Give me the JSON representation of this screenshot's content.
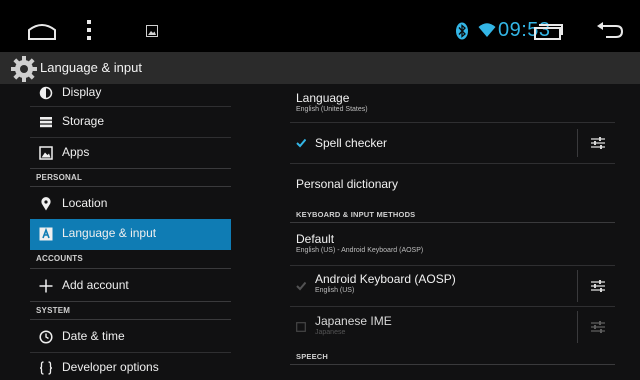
{
  "status_bar": {
    "time": "09:53",
    "icons": [
      "home-icon",
      "menu-icon",
      "screenshot-icon",
      "bluetooth-icon",
      "wifi-icon",
      "recent-apps-icon",
      "back-icon"
    ],
    "accent_color": "#33b5e5"
  },
  "action_bar": {
    "icon": "settings-gear-icon",
    "title": "Language & input"
  },
  "sidebar": {
    "items": [
      {
        "label": "Display",
        "icon": "display-icon"
      },
      {
        "label": "Storage",
        "icon": "storage-icon"
      },
      {
        "label": "Apps",
        "icon": "apps-icon"
      },
      {
        "label": "Location",
        "icon": "location-icon"
      },
      {
        "label": "Language & input",
        "icon": "language-icon",
        "selected": true
      },
      {
        "label": "Add account",
        "icon": "add-icon"
      },
      {
        "label": "Date & time",
        "icon": "clock-icon"
      },
      {
        "label": "Developer options",
        "icon": "braces-icon"
      }
    ],
    "sections": [
      "PERSONAL",
      "ACCOUNTS",
      "SYSTEM"
    ],
    "selected_color": "#0f7cb4"
  },
  "main": {
    "language": {
      "title": "Language",
      "summary": "English (United States)"
    },
    "spell_checker": {
      "title": "Spell checker",
      "checked": true
    },
    "personal_dictionary": {
      "title": "Personal dictionary"
    },
    "keyboard_category": "KEYBOARD & INPUT METHODS",
    "default_keyboard": {
      "title": "Default",
      "summary": "English (US) - Android Keyboard (AOSP)"
    },
    "android_keyboard": {
      "title": "Android Keyboard (AOSP)",
      "summary": "English (US)",
      "checked": true,
      "enabled": false
    },
    "japanese_ime": {
      "title": "Japanese IME",
      "summary": "Japanese",
      "checked": false,
      "enabled": false
    },
    "speech_category": "SPEECH"
  }
}
